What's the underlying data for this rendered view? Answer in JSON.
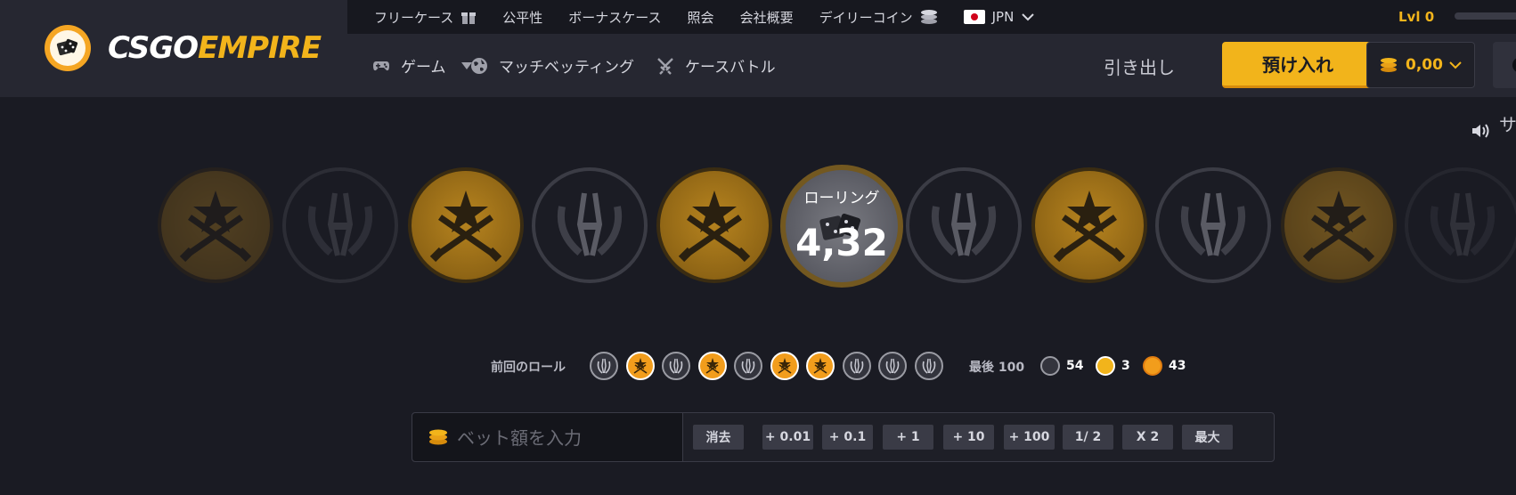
{
  "brand": {
    "part1": "CSGO",
    "part2": "EMPIRE"
  },
  "topbar": {
    "links": [
      "フリーケース",
      "公平性",
      "ボーナスケース",
      "照会",
      "会社概要",
      "デイリーコイン"
    ],
    "language": "JPN",
    "level": "Lvl 0"
  },
  "nav": {
    "items": [
      "ゲーム",
      "マッチベッティング",
      "ケースバトル"
    ],
    "withdraw": "引き出し",
    "deposit": "預け入れ",
    "balance": "0,00"
  },
  "sound_label": "サ",
  "roll": {
    "label": "ローリング",
    "value": "4,32"
  },
  "history": {
    "label": "前回のロール",
    "items": [
      "ct",
      "t",
      "ct",
      "t",
      "ct",
      "t",
      "t",
      "ct",
      "ct",
      "ct"
    ]
  },
  "stats": {
    "label": "最後 100",
    "ct_count": "54",
    "bonus_count": "3",
    "t_count": "43"
  },
  "bet": {
    "placeholder": "ベット額を入力",
    "buttons": [
      "消去",
      "+ 0.01",
      "+ 0.1",
      "+ 1",
      "+ 10",
      "+ 100",
      "1/ 2",
      "X 2",
      "最大"
    ]
  },
  "colors": {
    "accent": "#f2b41b",
    "background": "#1a1b23",
    "panel": "#262731"
  },
  "icons": [
    "gift-icon",
    "coins-icon",
    "gamepad-icon",
    "globe-icon",
    "swords-icon",
    "sound-icon",
    "dice-icon"
  ]
}
